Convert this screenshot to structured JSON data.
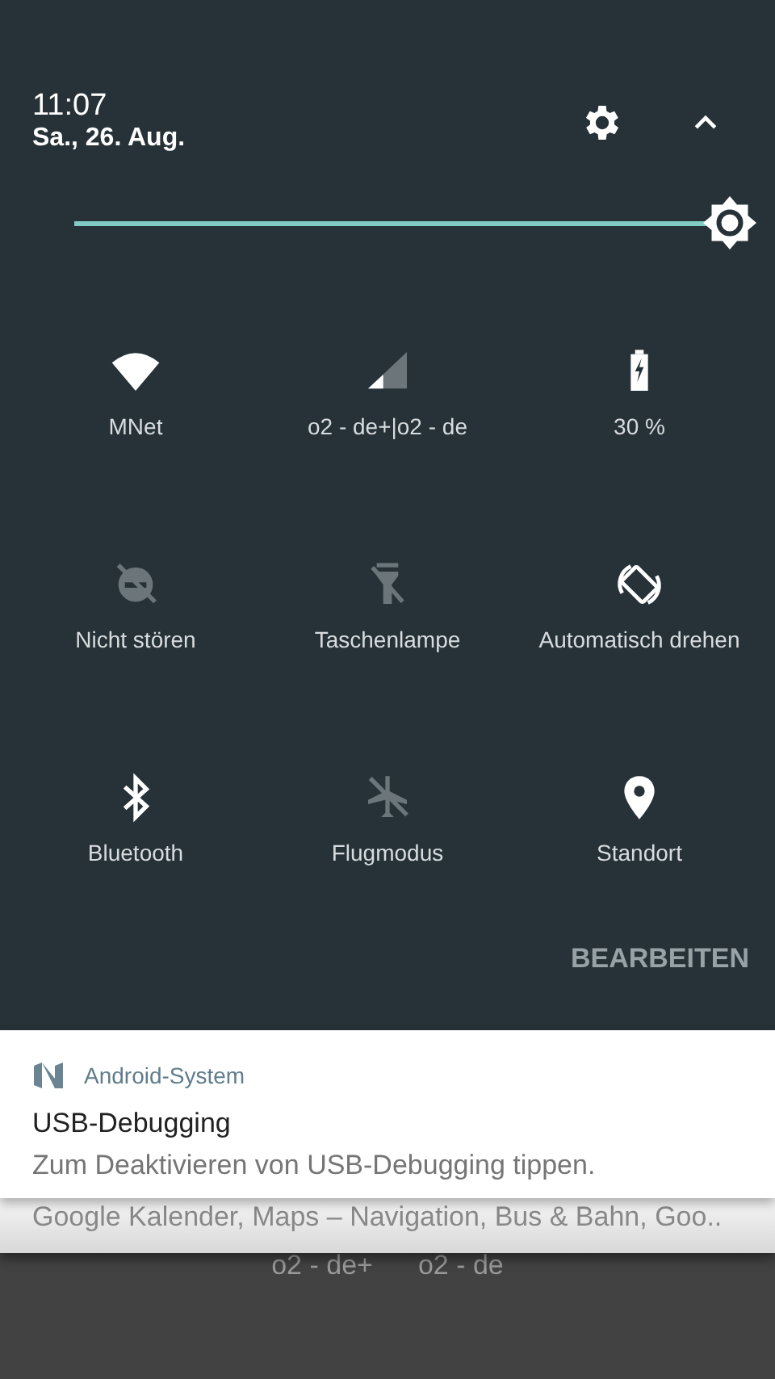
{
  "header": {
    "time": "11:07",
    "date": "Sa., 26. Aug."
  },
  "brightness": {
    "level": 1
  },
  "tiles": [
    {
      "kind": "wifi",
      "label": "MNet",
      "on": true
    },
    {
      "kind": "signal",
      "label": "o2 - de+|o2 - de",
      "on": true
    },
    {
      "kind": "battery",
      "label": "30 %",
      "on": true
    },
    {
      "kind": "dnd",
      "label": "Nicht stören",
      "on": false
    },
    {
      "kind": "flashlight",
      "label": "Taschenlampe",
      "on": false
    },
    {
      "kind": "rotate",
      "label": "Automatisch drehen",
      "on": true
    },
    {
      "kind": "bluetooth",
      "label": "Bluetooth",
      "on": true
    },
    {
      "kind": "airplane",
      "label": "Flugmodus",
      "on": false
    },
    {
      "kind": "location",
      "label": "Standort",
      "on": true
    }
  ],
  "edit_button": "BEARBEITEN",
  "notifications": [
    {
      "app": "Android-System",
      "title": "USB-Debugging",
      "text": "Zum Deaktivieren von USB-Debugging tippen."
    },
    {
      "text": "Google Kalender, Maps – Navigation, Bus & Bahn, Goo.."
    }
  ],
  "carrier_labels": [
    "o2 - de+",
    "o2 - de"
  ]
}
